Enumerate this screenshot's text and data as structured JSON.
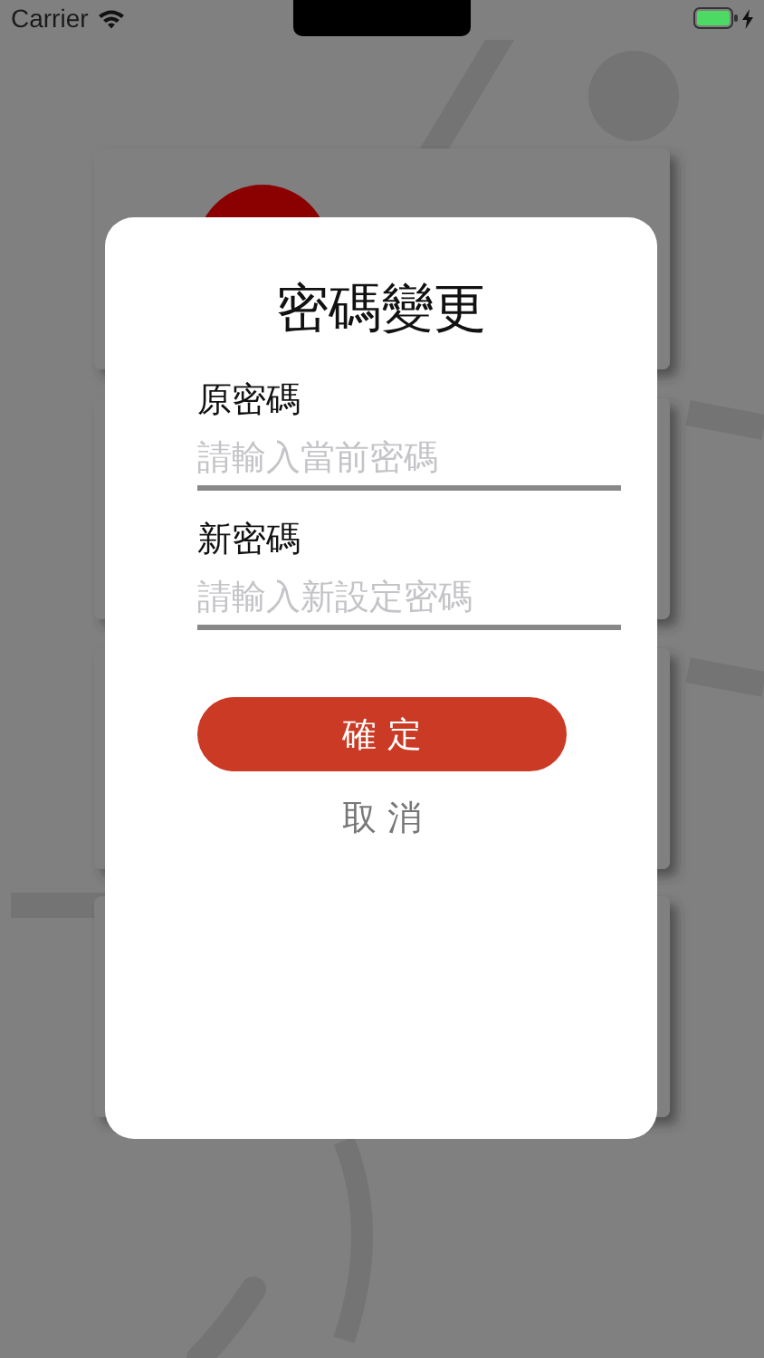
{
  "status_bar": {
    "carrier": "Carrier"
  },
  "dialog": {
    "title": "密碼變更",
    "fields": [
      {
        "label": "原密碼",
        "placeholder": "請輸入當前密碼"
      },
      {
        "label": "新密碼",
        "placeholder": "請輸入新設定密碼"
      }
    ],
    "confirm_button": "確 定",
    "cancel_button": "取 消"
  }
}
